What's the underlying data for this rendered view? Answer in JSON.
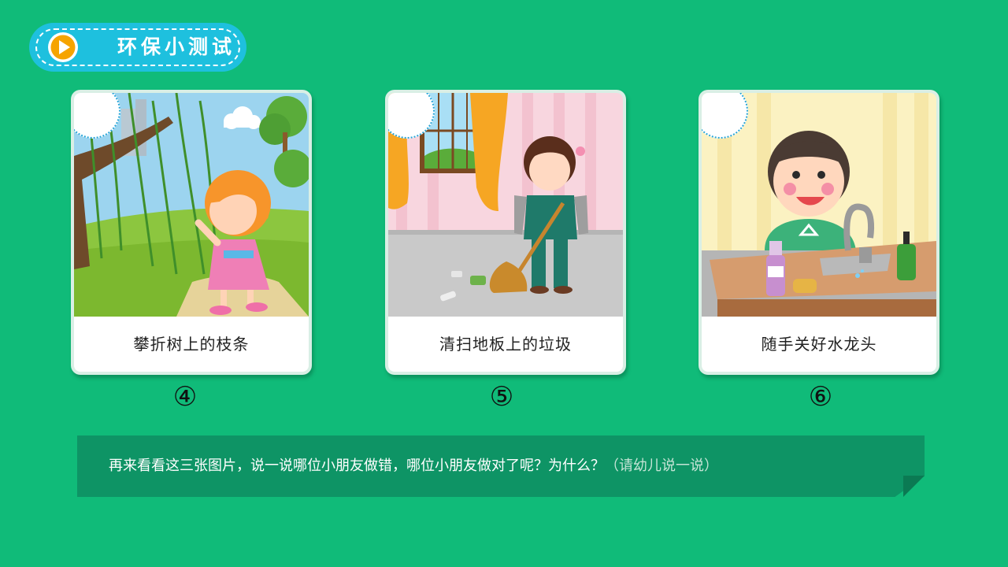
{
  "header": {
    "title": "环保小测试",
    "icon": "play-icon",
    "colors": {
      "pill": "#1ec0de",
      "play": "#f6a400"
    }
  },
  "cards": [
    {
      "caption": "攀折树上的枝条",
      "number": "④",
      "scene": "girl-breaking-willow-branch"
    },
    {
      "caption": "清扫地板上的垃圾",
      "number": "⑤",
      "scene": "girl-sweeping-floor"
    },
    {
      "caption": "随手关好水龙头",
      "number": "⑥",
      "scene": "boy-turning-off-faucet"
    }
  ],
  "banner": {
    "question": "再来看看这三张图片，说一说哪位小朋友做错，哪位小朋友做对了呢？为什么？",
    "hint": "（请幼儿说一说）"
  },
  "colors": {
    "background": "#10bb79",
    "banner": "#0e9465"
  }
}
